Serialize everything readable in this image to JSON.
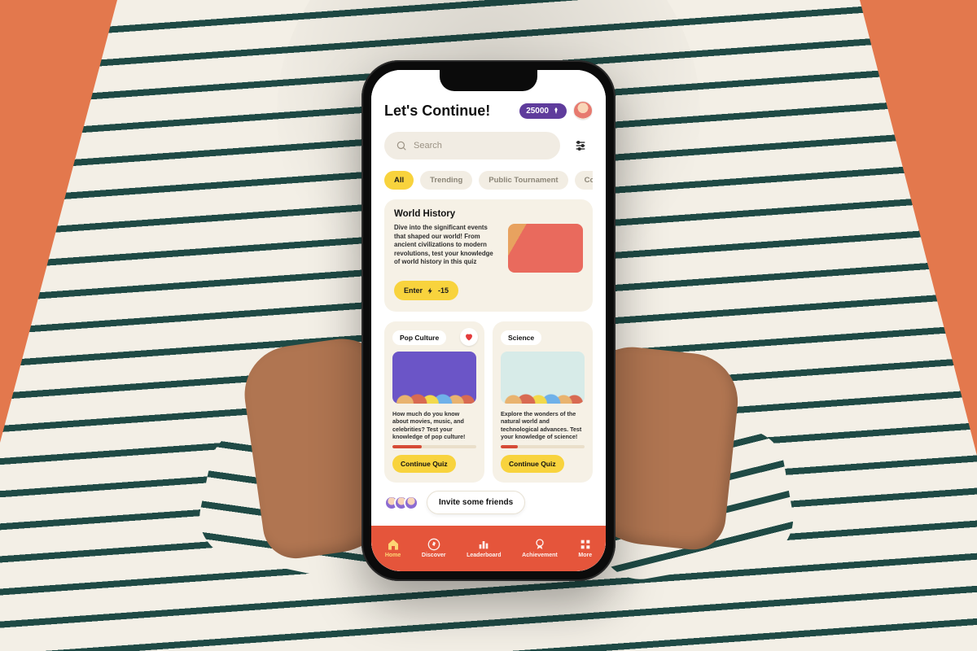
{
  "colors": {
    "accent": "#f8d33d",
    "brand": "#e5553b",
    "points": "#5f3c9c",
    "heart": "#e43b3b",
    "progress": "#d64b36"
  },
  "header": {
    "title": "Let's Continue!",
    "points": "25000"
  },
  "search": {
    "placeholder": "Search"
  },
  "chips": [
    {
      "label": "All",
      "active": true
    },
    {
      "label": "Trending",
      "active": false
    },
    {
      "label": "Public Tournament",
      "active": false
    },
    {
      "label": "Compe",
      "active": false
    }
  ],
  "hero": {
    "title": "World History",
    "desc": "Dive into the significant events that shaped our world! From ancient civilizations to modern revolutions, test your knowledge of world history in this quiz",
    "enter_label": "Enter",
    "enter_cost": "-15"
  },
  "mini": [
    {
      "tag": "Pop Culture",
      "favorite": true,
      "desc": "How much do you know about movies, music, and celebrities? Test your knowledge of pop culture!",
      "progress_pct": 35,
      "cta": "Continue Quiz"
    },
    {
      "tag": "Science",
      "favorite": false,
      "desc": "Explore the wonders of the natural world and technological advances. Test your knowledge of science!",
      "progress_pct": 20,
      "cta": "Continue Quiz"
    }
  ],
  "invite": {
    "label": "Invite some friends"
  },
  "nav": [
    {
      "label": "Home",
      "icon": "home",
      "active": true
    },
    {
      "label": "Discover",
      "icon": "compass",
      "active": false
    },
    {
      "label": "Leaderboard",
      "icon": "bars",
      "active": false
    },
    {
      "label": "Achievement",
      "icon": "medal",
      "active": false
    },
    {
      "label": "More",
      "icon": "grid",
      "active": false
    }
  ]
}
